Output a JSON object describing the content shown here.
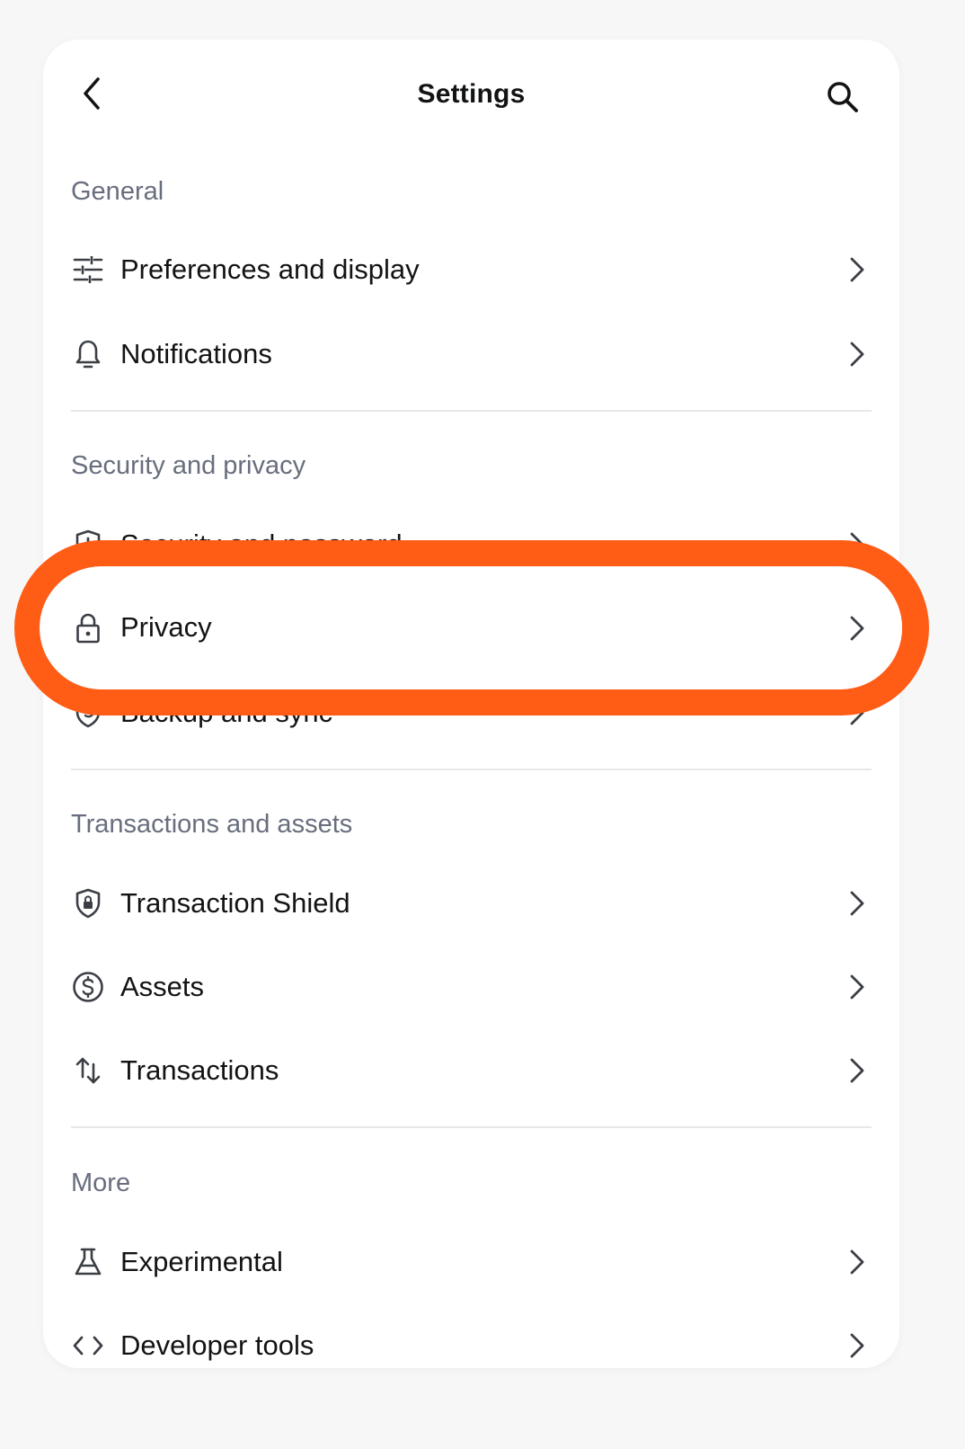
{
  "header": {
    "title": "Settings"
  },
  "sections": {
    "general": {
      "title": "General",
      "items": [
        {
          "label": "Preferences and display",
          "icon": "sliders-icon"
        },
        {
          "label": "Notifications",
          "icon": "bell-icon"
        }
      ]
    },
    "security": {
      "title": "Security and privacy",
      "items": [
        {
          "label": "Security and password",
          "icon": "shield-alert-icon"
        },
        {
          "label": "Privacy",
          "icon": "lock-icon"
        },
        {
          "label": "Backup and sync",
          "icon": "shield-sync-icon"
        }
      ]
    },
    "transactions": {
      "title": "Transactions and assets",
      "items": [
        {
          "label": "Transaction Shield",
          "icon": "shield-lock-icon"
        },
        {
          "label": "Assets",
          "icon": "dollar-circle-icon"
        },
        {
          "label": "Transactions",
          "icon": "arrows-up-down-icon"
        }
      ]
    },
    "more": {
      "title": "More",
      "items": [
        {
          "label": "Experimental",
          "icon": "flask-icon"
        },
        {
          "label": "Developer tools",
          "icon": "code-icon"
        }
      ]
    }
  },
  "highlight": {
    "target": "Privacy",
    "color": "#ff5c16"
  },
  "colors": {
    "text": "#121314",
    "muted": "#686e7d",
    "divider": "#e6e7e9",
    "icon": "#3b3f45"
  }
}
